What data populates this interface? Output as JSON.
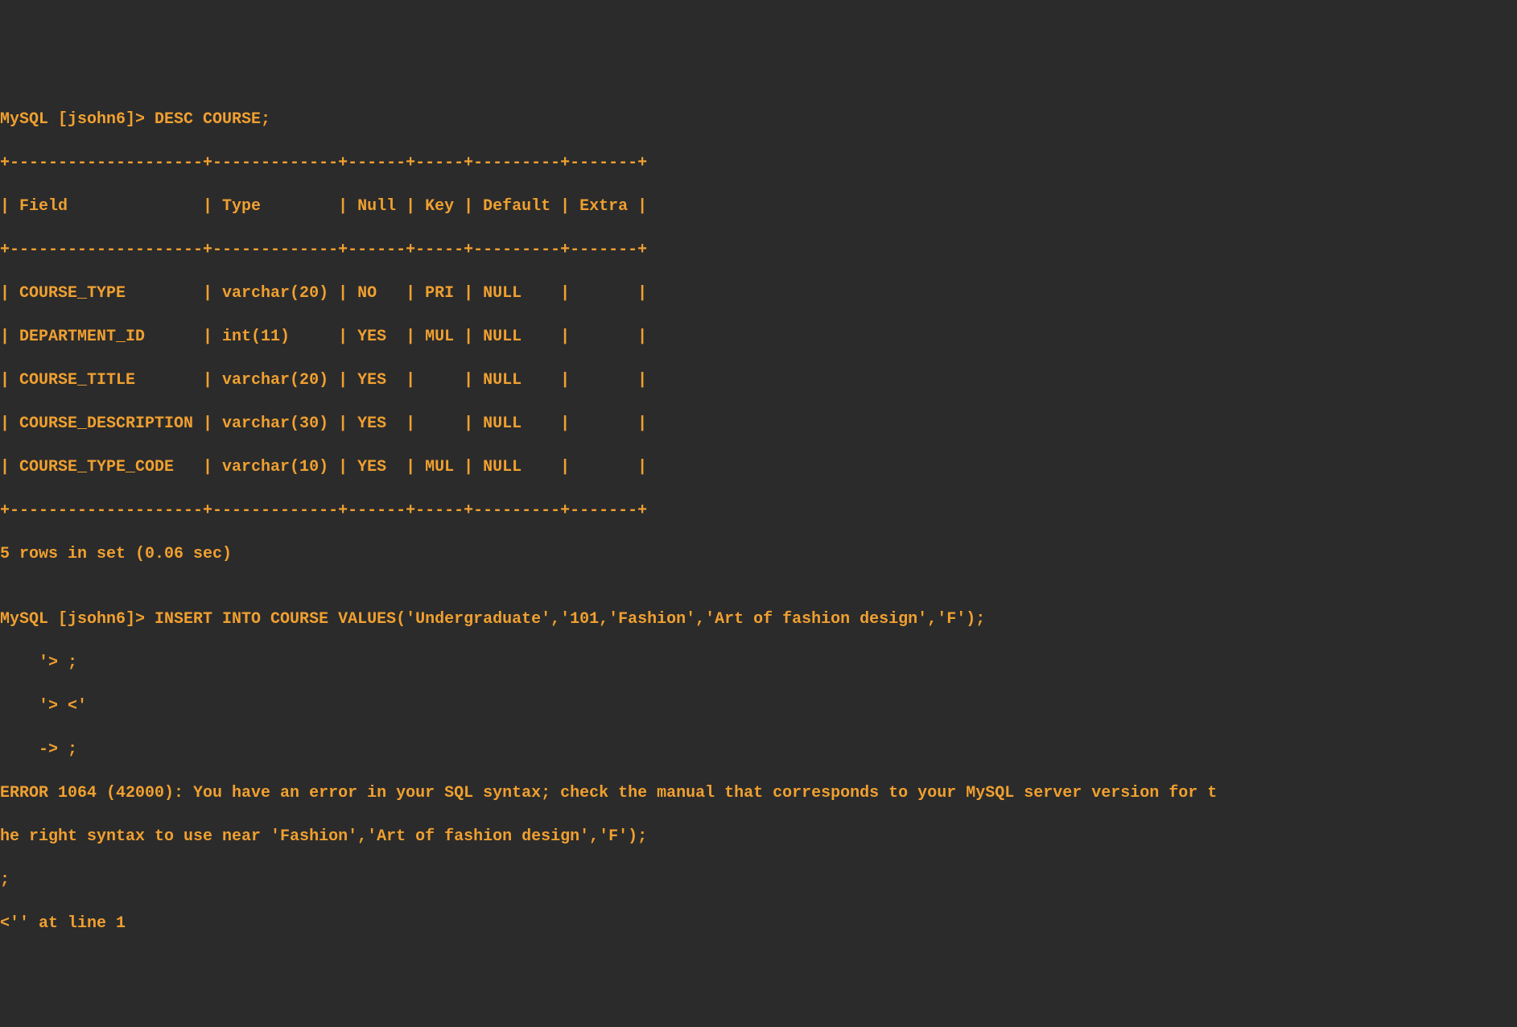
{
  "prompt1": "MySQL [jsohn6]> DESC COURSE;",
  "separator_top": "+--------------------+-------------+------+-----+---------+-------+",
  "header_row": "| Field              | Type        | Null | Key | Default | Extra |",
  "separator_mid": "+--------------------+-------------+------+-----+---------+-------+",
  "row1": "| COURSE_TYPE        | varchar(20) | NO   | PRI | NULL    |       |",
  "row2": "| DEPARTMENT_ID      | int(11)     | YES  | MUL | NULL    |       |",
  "row3": "| COURSE_TITLE       | varchar(20) | YES  |     | NULL    |       |",
  "row4": "| COURSE_DESCRIPTION | varchar(30) | YES  |     | NULL    |       |",
  "row5": "| COURSE_TYPE_CODE   | varchar(10) | YES  | MUL | NULL    |       |",
  "separator_bot": "+--------------------+-------------+------+-----+---------+-------+",
  "result_line": "5 rows in set (0.06 sec)",
  "blank": "",
  "prompt2": "MySQL [jsohn6]> INSERT INTO COURSE VALUES('Undergraduate','101,'Fashion','Art of fashion design','F');",
  "cont1": "    '> ;",
  "cont2": "    '> <'",
  "cont3": "    -> ;",
  "error_line1": "ERROR 1064 (42000): You have an error in your SQL syntax; check the manual that corresponds to your MySQL server version for t",
  "error_line2": "he right syntax to use near 'Fashion','Art of fashion design','F');",
  "error_line3": ";",
  "error_line4": "<'' at line 1",
  "chart_data": {
    "type": "table",
    "title": "DESC COURSE",
    "columns": [
      "Field",
      "Type",
      "Null",
      "Key",
      "Default",
      "Extra"
    ],
    "rows": [
      [
        "COURSE_TYPE",
        "varchar(20)",
        "NO",
        "PRI",
        "NULL",
        ""
      ],
      [
        "DEPARTMENT_ID",
        "int(11)",
        "YES",
        "MUL",
        "NULL",
        ""
      ],
      [
        "COURSE_TITLE",
        "varchar(20)",
        "YES",
        "",
        "NULL",
        ""
      ],
      [
        "COURSE_DESCRIPTION",
        "varchar(30)",
        "YES",
        "",
        "NULL",
        ""
      ],
      [
        "COURSE_TYPE_CODE",
        "varchar(10)",
        "YES",
        "MUL",
        "NULL",
        ""
      ]
    ]
  }
}
